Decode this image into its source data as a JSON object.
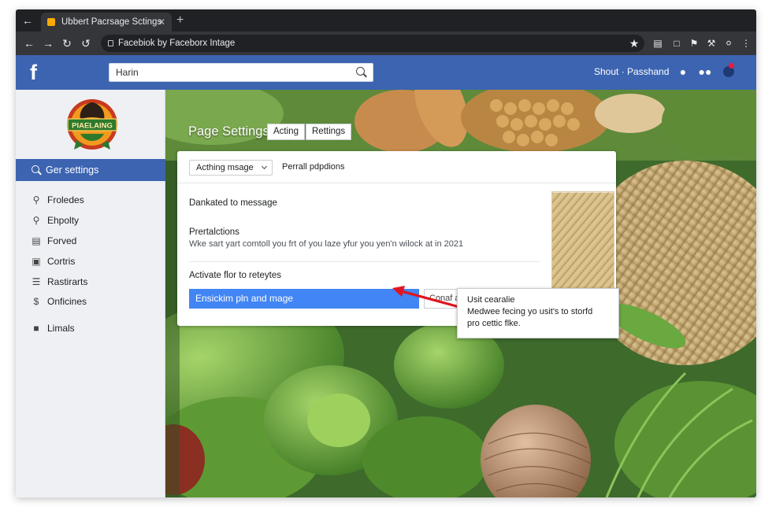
{
  "browser": {
    "tab_title": "Ubbert Pacrsage Sctings",
    "url": "Facebiok by Faceborx Intage"
  },
  "facebook": {
    "search_value": "Harin",
    "user_link": "Shout · Passhand"
  },
  "sidebar": {
    "logo_text": "PIAELAING",
    "active_item": "Ger settings",
    "items": [
      {
        "label": "Froledes",
        "icon": "search-icon"
      },
      {
        "label": "Ehpolty",
        "icon": "pin-icon"
      },
      {
        "label": "Forved",
        "icon": "document-icon"
      },
      {
        "label": "Cortris",
        "icon": "contact-icon"
      },
      {
        "label": "Rastirarts",
        "icon": "list-icon"
      },
      {
        "label": "Onficines",
        "icon": "dollar-icon"
      },
      {
        "label": "Limals",
        "icon": "lock-icon"
      }
    ]
  },
  "page_settings": {
    "title": "Page Settings",
    "tabs": [
      "Acting",
      "Rettings"
    ],
    "dropdown_value": "Acthing msage",
    "secondary_tab": "Perrall pdpdions",
    "row1": "Dankated to message",
    "row2_title": "Prertalctions",
    "row2_sub": "Wke sart yart comtoll you frt of you laze yfur you yen'n wilock at in 2021",
    "row3": "Activate flor to reteytes",
    "primary_button": "Ensickim pln and mage",
    "secondary_button": "Conaf a",
    "tooltip_line1": "Usit cearalie",
    "tooltip_line2": "Medwee fecing yo usit's to storfd",
    "tooltip_line3": "pro cettic flke."
  },
  "colors": {
    "facebook_blue": "#3c64b1",
    "primary_button": "#4285f4",
    "arrow": "#e0151f"
  }
}
